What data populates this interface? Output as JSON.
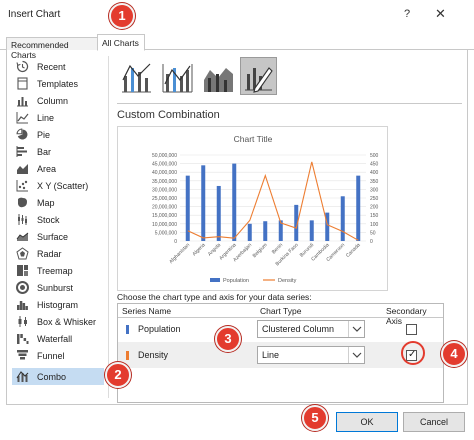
{
  "window": {
    "title": "Insert Chart",
    "help": "?",
    "close": "✕"
  },
  "tabs": [
    {
      "label": "Recommended Charts"
    },
    {
      "label": "All Charts"
    }
  ],
  "sidebar": {
    "items": [
      {
        "label": "Recent",
        "icon": "recent-icon"
      },
      {
        "label": "Templates",
        "icon": "templates-icon"
      },
      {
        "label": "Column",
        "icon": "column-icon"
      },
      {
        "label": "Line",
        "icon": "line-icon"
      },
      {
        "label": "Pie",
        "icon": "pie-icon"
      },
      {
        "label": "Bar",
        "icon": "bar-icon"
      },
      {
        "label": "Area",
        "icon": "area-icon"
      },
      {
        "label": "X Y (Scatter)",
        "icon": "scatter-icon"
      },
      {
        "label": "Map",
        "icon": "map-icon"
      },
      {
        "label": "Stock",
        "icon": "stock-icon"
      },
      {
        "label": "Surface",
        "icon": "surface-icon"
      },
      {
        "label": "Radar",
        "icon": "radar-icon"
      },
      {
        "label": "Treemap",
        "icon": "treemap-icon"
      },
      {
        "label": "Sunburst",
        "icon": "sunburst-icon"
      },
      {
        "label": "Histogram",
        "icon": "histogram-icon"
      },
      {
        "label": "Box & Whisker",
        "icon": "box-whisker-icon"
      },
      {
        "label": "Waterfall",
        "icon": "waterfall-icon"
      },
      {
        "label": "Funnel",
        "icon": "funnel-icon"
      },
      {
        "label": "Combo",
        "icon": "combo-icon",
        "selected": true
      }
    ]
  },
  "section_title": "Custom Combination",
  "choose_label": "Choose the chart type and axis for your data series:",
  "series_table": {
    "headers": {
      "name": "Series Name",
      "type": "Chart Type",
      "axis": "Secondary Axis"
    },
    "rows": [
      {
        "name": "Population",
        "type": "Clustered Column",
        "secondary": false,
        "color": "#4472c4"
      },
      {
        "name": "Density",
        "type": "Line",
        "secondary": true,
        "color": "#ed7d31"
      }
    ]
  },
  "buttons": {
    "ok": "OK",
    "cancel": "Cancel"
  },
  "badges": [
    "1",
    "2",
    "3",
    "4",
    "5"
  ],
  "colors": {
    "accent": "#0078d7",
    "badge": "#e33b2e",
    "selection": "#c5dcf2"
  },
  "chart_data": {
    "type": "bar",
    "title": "Chart Title",
    "categories": [
      "Afghanistan",
      "Algeria",
      "Angola",
      "Argentina",
      "Azerbaijan",
      "Belgium",
      "Benin",
      "Burkina Faso",
      "Burundi",
      "Cambodia",
      "Cameroon",
      "Canada"
    ],
    "series": [
      {
        "name": "Population",
        "type": "bar",
        "axis": "primary",
        "color": "#4472c4",
        "values": [
          38000000,
          44000000,
          32000000,
          45000000,
          10000000,
          11500000,
          12000000,
          21000000,
          12000000,
          16500000,
          26000000,
          38000000
        ]
      },
      {
        "name": "Density",
        "type": "line",
        "axis": "secondary",
        "color": "#ed7d31",
        "values": [
          60,
          18,
          25,
          16,
          120,
          380,
          105,
          75,
          460,
          95,
          55,
          4
        ]
      }
    ],
    "y_ticks": [
      "0",
      "5,000,000",
      "10,000,000",
      "15,000,000",
      "20,000,000",
      "25,000,000",
      "30,000,000",
      "35,000,000",
      "40,000,000",
      "45,000,000",
      "50,000,000"
    ],
    "y2_ticks": [
      "0",
      "50",
      "100",
      "150",
      "200",
      "250",
      "300",
      "350",
      "400",
      "450",
      "500"
    ],
    "ylim": [
      0,
      50000000
    ],
    "y2lim": [
      0,
      500
    ],
    "legend": "bottom"
  }
}
